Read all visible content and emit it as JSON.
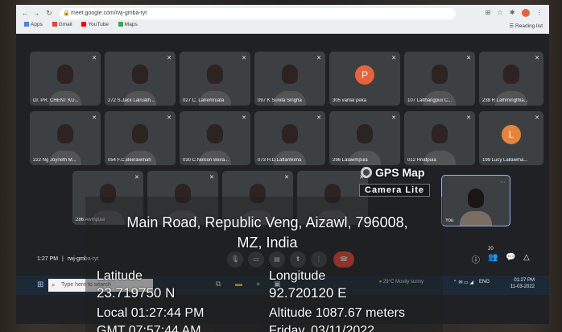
{
  "browser": {
    "url": "meet.google.com/rwj-gmba-tyt",
    "bookmarks": [
      "Apps",
      "Gmail",
      "YouTube",
      "Maps"
    ],
    "reading_list": "Reading list"
  },
  "meet": {
    "participants": [
      {
        "name": "Dr. PR. CHENT KU..."
      },
      {
        "name": "272 S.Jack Lalruath..."
      },
      {
        "name": "027 C. Lalremruata"
      },
      {
        "name": "097 K Sunita Singha"
      },
      {
        "name": "305 vanlal peka",
        "initial": "P",
        "color": "#e8633a"
      },
      {
        "name": "107 Lalthangpuii C..."
      },
      {
        "name": "238 R Lalhmingthia..."
      },
      {
        "name": "222 Ng Joyneth M..."
      },
      {
        "name": "054 F.C.Beinawmah"
      },
      {
        "name": "030 C.Nelson Beira..."
      },
      {
        "name": "073 H.D.Lalfamkima"
      },
      {
        "name": "296 Lalawmpuia"
      },
      {
        "name": "012 Hriatpuia"
      },
      {
        "name": "199 Lucy Lallawma...",
        "initial": "L",
        "color": "#e8833a"
      },
      {
        "name": "286 Awmpuia"
      },
      {
        "name": ""
      },
      {
        "name": ""
      },
      {
        "name": ""
      },
      {
        "name": "You"
      }
    ],
    "time": "1:27 PM",
    "separator": "|",
    "meeting_code": "rwj-gmba-tyt",
    "participant_count": "20"
  },
  "taskbar": {
    "search_placeholder": "Type here to search",
    "weather": "29°C  Mostly sunny",
    "language": "ENG",
    "clock_time": "01:27 PM",
    "clock_date": "11-03-2022"
  },
  "gps": {
    "app_title": "GPS Map",
    "app_subtitle": "Camera Lite",
    "address_line1": "Main Road, Republic Veng, Aizawl, 796008,",
    "address_line2": "MZ, India",
    "latitude_label": "Latitude",
    "latitude_value": "23.719750 N",
    "longitude_label": "Longitude",
    "longitude_value": "92.720120 E",
    "local_time": "Local 01:27:44 PM",
    "altitude": "Altitude  1087.67 meters",
    "gmt_time": "GMT 07:57:44 AM",
    "date": "Friday, 03/11/2022"
  },
  "colors": {
    "meet_bg": "#202124",
    "end_call": "#ea4335",
    "self_border": "#8ab4f8"
  }
}
